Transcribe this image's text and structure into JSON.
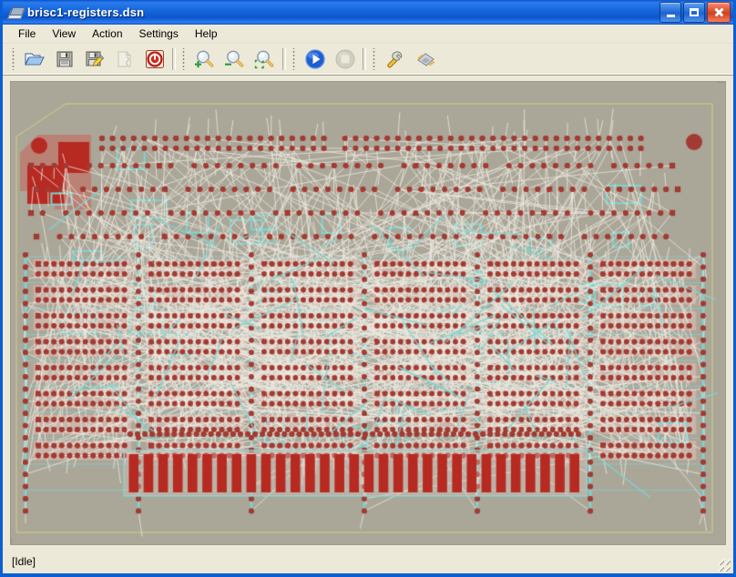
{
  "window": {
    "title": "brisc1-registers.dsn",
    "icon": "pcb-board-icon",
    "controls": [
      {
        "name": "minimize-button",
        "glyph": "minimize"
      },
      {
        "name": "maximize-button",
        "glyph": "maximize"
      },
      {
        "name": "close-button",
        "glyph": "close"
      }
    ]
  },
  "menubar": {
    "items": [
      {
        "label": "File",
        "name": "menu-file"
      },
      {
        "label": "View",
        "name": "menu-view"
      },
      {
        "label": "Action",
        "name": "menu-action"
      },
      {
        "label": "Settings",
        "name": "menu-settings"
      },
      {
        "label": "Help",
        "name": "menu-help"
      }
    ]
  },
  "toolbar": {
    "groups": [
      {
        "buttons": [
          {
            "name": "open-file-button",
            "icon": "open-folder-icon",
            "label": "Open",
            "enabled": true
          },
          {
            "name": "save-button",
            "icon": "floppy-disk-icon",
            "label": "Save",
            "enabled": true
          },
          {
            "name": "save-as-button",
            "icon": "floppy-disk-pencil-icon",
            "label": "Save As",
            "enabled": true
          },
          {
            "name": "new-rules-button",
            "icon": "document-icon",
            "label": "Rules",
            "enabled": false
          },
          {
            "name": "cancel-button",
            "icon": "power-cancel-icon",
            "label": "Cancel",
            "enabled": true
          }
        ]
      },
      {
        "buttons": [
          {
            "name": "zoom-in-button",
            "icon": "magnifier-plus-icon",
            "label": "Zoom In",
            "enabled": true
          },
          {
            "name": "zoom-out-button",
            "icon": "magnifier-minus-icon",
            "label": "Zoom Out",
            "enabled": true
          },
          {
            "name": "zoom-fit-button",
            "icon": "magnifier-fit-icon",
            "label": "Zoom Fit",
            "enabled": true
          }
        ]
      },
      {
        "buttons": [
          {
            "name": "autoroute-start-button",
            "icon": "play-icon",
            "label": "Start",
            "enabled": true
          },
          {
            "name": "autoroute-stop-button",
            "icon": "stop-icon",
            "label": "Stop",
            "enabled": false
          }
        ]
      },
      {
        "buttons": [
          {
            "name": "tools-button",
            "icon": "wrench-icon",
            "label": "Tools",
            "enabled": true
          },
          {
            "name": "board-button",
            "icon": "chip-icon",
            "label": "Board",
            "enabled": true
          }
        ]
      }
    ]
  },
  "statusbar": {
    "text": "[Idle]",
    "resize_grip": "resize-grip-icon"
  },
  "canvas": {
    "name": "pcb-layout-canvas",
    "background": "#aaa698",
    "board_outline_color": "#d8cf84",
    "colors": {
      "pad": "#a23b33",
      "pad_dark": "#9c2f26",
      "component_fill": "#e3c4bd",
      "component_outline": "#c9a49c",
      "trace_cyan": "#7fd4d0",
      "airwire": "#ece8de",
      "keepout_red": "#c46a60",
      "keepout_solid": "#b62a22"
    },
    "layout": {
      "view_width": 776,
      "view_height": 501,
      "top_pad_rows": 2,
      "component_columns": 6,
      "component_rows": 9,
      "dip_pins_per_row": 12,
      "edge_connector_fingers": 31,
      "mounting_holes": 2
    }
  }
}
